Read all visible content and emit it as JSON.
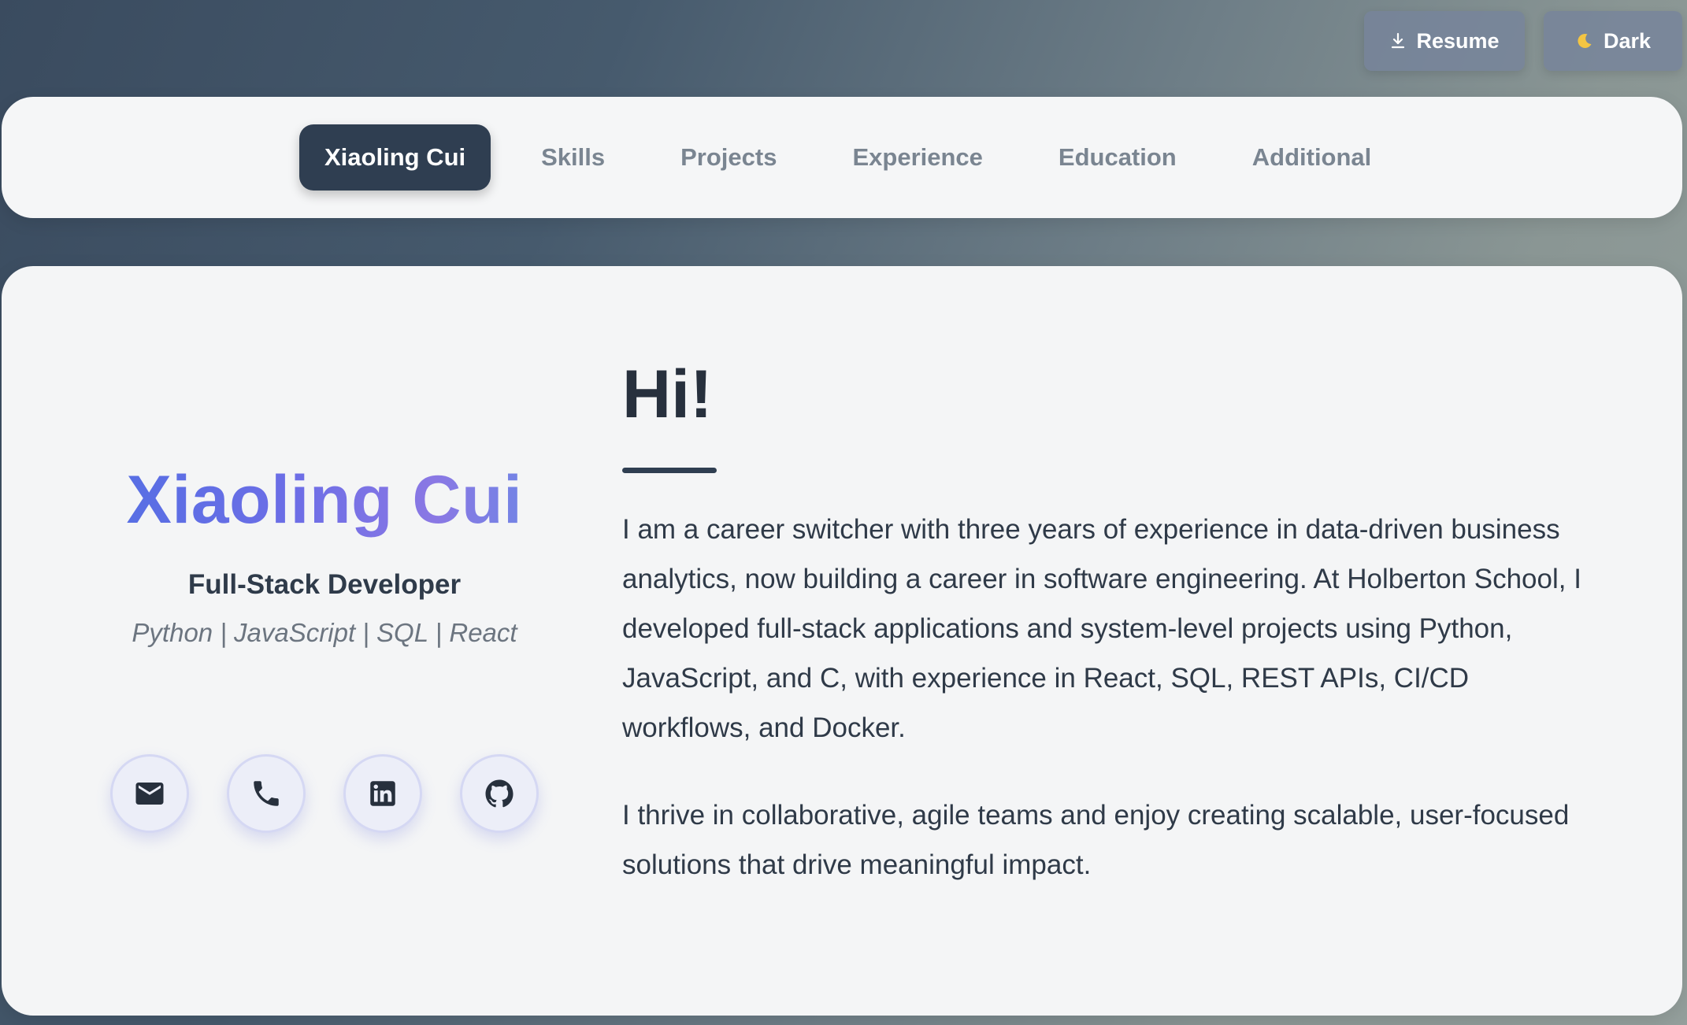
{
  "header_actions": {
    "resume_label": "Resume",
    "resume_icon": "download-icon",
    "theme_label": "Dark",
    "theme_icon": "moon-icon"
  },
  "nav": {
    "tabs": [
      {
        "label": "Xiaoling Cui",
        "active": true
      },
      {
        "label": "Skills",
        "active": false
      },
      {
        "label": "Projects",
        "active": false
      },
      {
        "label": "Experience",
        "active": false
      },
      {
        "label": "Education",
        "active": false
      },
      {
        "label": "Additional",
        "active": false
      }
    ]
  },
  "profile": {
    "name": "Xiaoling Cui",
    "role": "Full-Stack Developer",
    "stack": "Python | JavaScript | SQL | React",
    "contacts": [
      {
        "icon": "email-icon"
      },
      {
        "icon": "phone-icon"
      },
      {
        "icon": "linkedin-icon"
      },
      {
        "icon": "github-icon"
      }
    ]
  },
  "about": {
    "heading": "Hi!",
    "paragraphs": [
      "I am a career switcher with three years of experience in data-driven business analytics, now building a career in software engineering. At Holberton School, I developed full-stack applications and system-level projects using Python, JavaScript, and C, with experience in React, SQL, REST APIs, CI/CD workflows, and Docker.",
      "I thrive in collaborative, agile teams and enjoy creating scalable, user-focused solutions that drive meaningful impact."
    ]
  },
  "colors": {
    "nav_active_bg": "#2f3e51",
    "name_gradient_start": "#4e6fe3",
    "name_gradient_end": "#8a78e4",
    "contact_icon": "#27303d"
  }
}
